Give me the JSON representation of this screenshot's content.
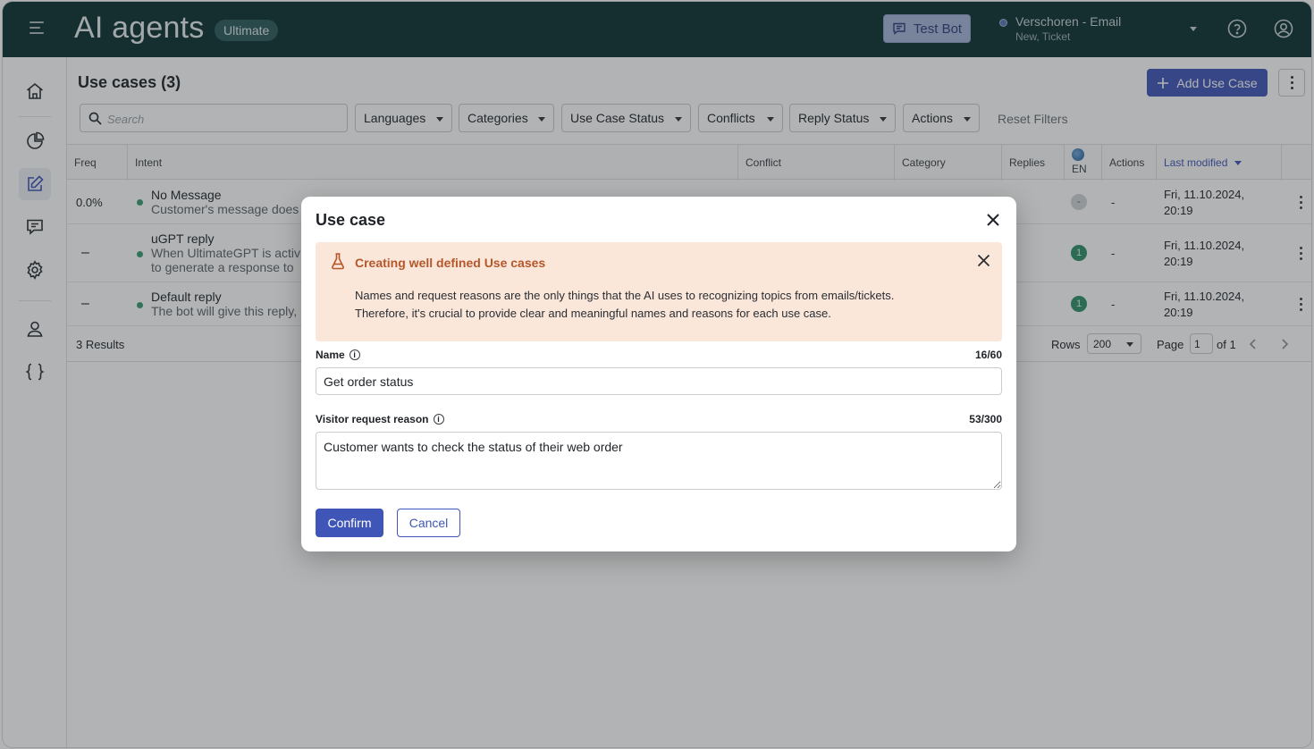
{
  "header": {
    "app_title": "AI agents",
    "plan_badge": "Ultimate",
    "test_bot_label": "Test Bot",
    "channel_name": "Verschoren - Email",
    "channel_sub": "New, Ticket"
  },
  "sidebar": {
    "items": [
      {
        "icon": "home-icon"
      },
      {
        "icon": "analytics-icon"
      },
      {
        "icon": "edit-icon",
        "active": true
      },
      {
        "icon": "chat-icon"
      },
      {
        "icon": "settings-icon"
      },
      {
        "icon": "user-icon"
      },
      {
        "icon": "code-braces-icon"
      }
    ]
  },
  "page": {
    "title": "Use cases (3)",
    "add_button": "Add Use Case",
    "search_placeholder": "Search",
    "filters": [
      "Languages",
      "Categories",
      "Use Case Status",
      "Conflicts",
      "Reply Status",
      "Actions"
    ],
    "reset_filters": "Reset Filters"
  },
  "table": {
    "columns": [
      "Freq",
      "Intent",
      "Conflict",
      "Category",
      "Replies",
      "EN",
      "Actions",
      "Last modified"
    ],
    "rows": [
      {
        "freq": "0.0%",
        "title": "No Message",
        "desc1": "Customer's message does",
        "desc2": "",
        "en": "-",
        "actions": "-",
        "modified1": "Fri, 11.10.2024,",
        "modified2": "20:19"
      },
      {
        "freq": "–",
        "title": "uGPT reply",
        "desc1": "When UltimateGPT is activ",
        "desc2": "to generate a response to",
        "en": "1",
        "actions": "-",
        "modified1": "Fri, 11.10.2024,",
        "modified2": "20:19"
      },
      {
        "freq": "–",
        "title": "Default reply",
        "desc1": "The bot will give this reply,",
        "desc2": "",
        "en": "1",
        "actions": "-",
        "modified1": "Fri, 11.10.2024,",
        "modified2": "20:19"
      }
    ],
    "results": "3 Results",
    "rows_label": "Rows",
    "rows_value": "200",
    "page_label": "Page",
    "page_value": "1",
    "page_of": "of 1"
  },
  "modal": {
    "title": "Use case",
    "info_title": "Creating well defined Use cases",
    "info_line1": "Names and request reasons are the only things that the AI uses to recognizing topics from emails/tickets.",
    "info_line2": "Therefore, it's crucial to provide clear and meaningful names and reasons for each use case.",
    "name_label": "Name",
    "name_counter": "16/60",
    "name_value": "Get order status",
    "reason_label": "Visitor request reason",
    "reason_counter": "53/300",
    "reason_value": "Customer wants to check the status of their web order",
    "confirm_label": "Confirm",
    "cancel_label": "Cancel"
  },
  "colors": {
    "topbar": "#0b2f31",
    "primary": "#3f55b7",
    "info_bg": "#fbe6da",
    "info_title": "#b4572a"
  }
}
